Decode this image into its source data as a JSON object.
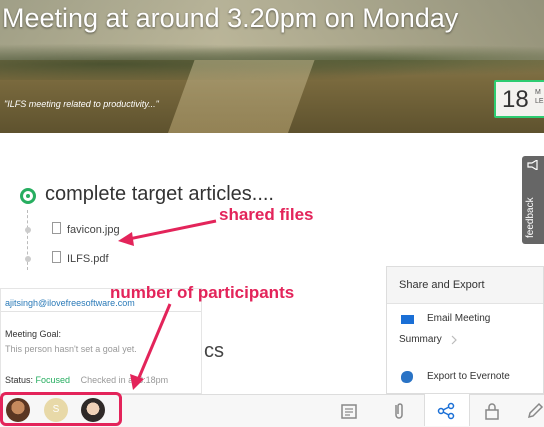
{
  "meeting": {
    "title": "Meeting at around 3.20pm on Monday",
    "quote": "\"ILFS meeting related to productivity...\"",
    "date": {
      "day": "18",
      "line1": "M",
      "line2": "LE"
    }
  },
  "feedback": {
    "label": "feedback"
  },
  "task": {
    "title": "complete target articles....",
    "files": [
      {
        "name": "favicon.jpg"
      },
      {
        "name": "ILFS.pdf"
      }
    ]
  },
  "annotations": {
    "shared_files": "shared files",
    "participants": "number of participants"
  },
  "share_panel": {
    "heading": "Share and Export",
    "email": "Email Meeting",
    "summary": "Summary",
    "evernote": "Export to Evernote"
  },
  "participant_card": {
    "email": "ajitsingh@ilovefreesoftware.com",
    "goal_label": "Meeting Goal:",
    "goal_text": "This person hasn't set a goal yet.",
    "status_label": "Status:",
    "status_value": "Focused",
    "checked_in": "Checked in at 3:18pm"
  },
  "partial_text": "cs",
  "participants": [
    {
      "initial": "",
      "color": "#8a5a3c"
    },
    {
      "initial": "S",
      "color": "#e8d9a8"
    },
    {
      "initial": "",
      "color": "#d9b79a"
    }
  ],
  "colors": {
    "accent": "#e3245a",
    "green": "#27ae60",
    "link": "#2a7ab8"
  }
}
